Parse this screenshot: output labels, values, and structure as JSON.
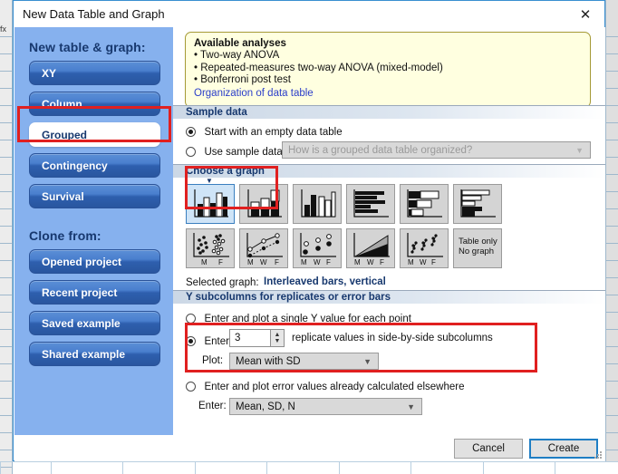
{
  "window": {
    "title": "New Data Table and Graph",
    "close_icon": "close-icon",
    "close_glyph": "✕"
  },
  "sidebar": {
    "new_heading": "New table & graph:",
    "new_items": [
      {
        "label": "XY",
        "selected": false
      },
      {
        "label": "Column",
        "selected": false
      },
      {
        "label": "Grouped",
        "selected": true
      },
      {
        "label": "Contingency",
        "selected": false
      },
      {
        "label": "Survival",
        "selected": false
      }
    ],
    "clone_heading": "Clone from:",
    "clone_items": [
      {
        "label": "Opened project"
      },
      {
        "label": "Recent project"
      },
      {
        "label": "Saved example"
      },
      {
        "label": "Shared example"
      }
    ]
  },
  "info_box": {
    "title": "Available analyses",
    "bullets": [
      "• Two-way ANOVA",
      "• Repeated-measures two-way ANOVA (mixed-model)",
      "• Bonferroni post test"
    ],
    "link": "Organization of data table"
  },
  "sample_data": {
    "header": "Sample data",
    "option_empty": "Start with an empty data table",
    "option_sample": "Use sample data",
    "sample_combo_value": "How is a grouped data table organized?",
    "sample_combo_enabled": false,
    "selected": "empty"
  },
  "choose_graph": {
    "header": "Choose a graph",
    "selected_index": 0,
    "selected_label_prefix": "Selected graph:",
    "selected_label_value": "Interleaved bars, vertical",
    "thumbnails": [
      {
        "name": "interleaved-bars-vertical",
        "kind": "bars-interleaved-v"
      },
      {
        "name": "stacked-bars-vertical",
        "kind": "bars-stacked-v"
      },
      {
        "name": "grouped-bars-vertical",
        "kind": "bars-grouped-v"
      },
      {
        "name": "interleaved-bars-horizontal",
        "kind": "bars-interleaved-h"
      },
      {
        "name": "grouped-bars-horizontal",
        "kind": "bars-grouped-h"
      },
      {
        "name": "stacked-bars-horizontal",
        "kind": "bars-stacked-h"
      },
      {
        "name": "scatter-dot-plot",
        "kind": "scatter-dots",
        "axis": [
          "M",
          "F"
        ]
      },
      {
        "name": "before-after-line-plot",
        "kind": "line-points",
        "axis": [
          "M",
          "W",
          "F"
        ]
      },
      {
        "name": "symbol-plot",
        "kind": "symbols",
        "axis": [
          "M",
          "W",
          "F"
        ]
      },
      {
        "name": "area-plot",
        "kind": "area",
        "axis": [
          "M",
          "W",
          "F"
        ]
      },
      {
        "name": "grouped-scatter-plot",
        "kind": "grouped-scatter",
        "axis": [
          "M",
          "W",
          "F"
        ]
      },
      {
        "name": "table-only-no-graph",
        "kind": "text",
        "line1": "Table only",
        "line2": "No graph"
      }
    ]
  },
  "subcolumns": {
    "header": "Y subcolumns for replicates or error bars",
    "option_single": "Enter and plot a single Y value for each point",
    "option_replicates_prefix": "Enter",
    "replicate_count": "3",
    "option_replicates_suffix": "replicate values in side-by-side subcolumns",
    "plot_label": "Plot:",
    "plot_value": "Mean with SD",
    "option_errors": "Enter and plot error values already calculated elsewhere",
    "enter_label": "Enter:",
    "enter_value": "Mean, SD, N",
    "selected": "replicates"
  },
  "footer": {
    "cancel_label": "Cancel",
    "create_label": "Create"
  },
  "background": {
    "formula_bar_label": "fx"
  },
  "colors": {
    "accent_blue": "#3a8fd0",
    "panel_blue": "#86b1ee",
    "button_blue": "#2e5fae",
    "heading_navy": "#17386e",
    "info_yellow": "#ffffe0",
    "annotation_red": "#e02020",
    "link_blue": "#2b3ec9"
  }
}
